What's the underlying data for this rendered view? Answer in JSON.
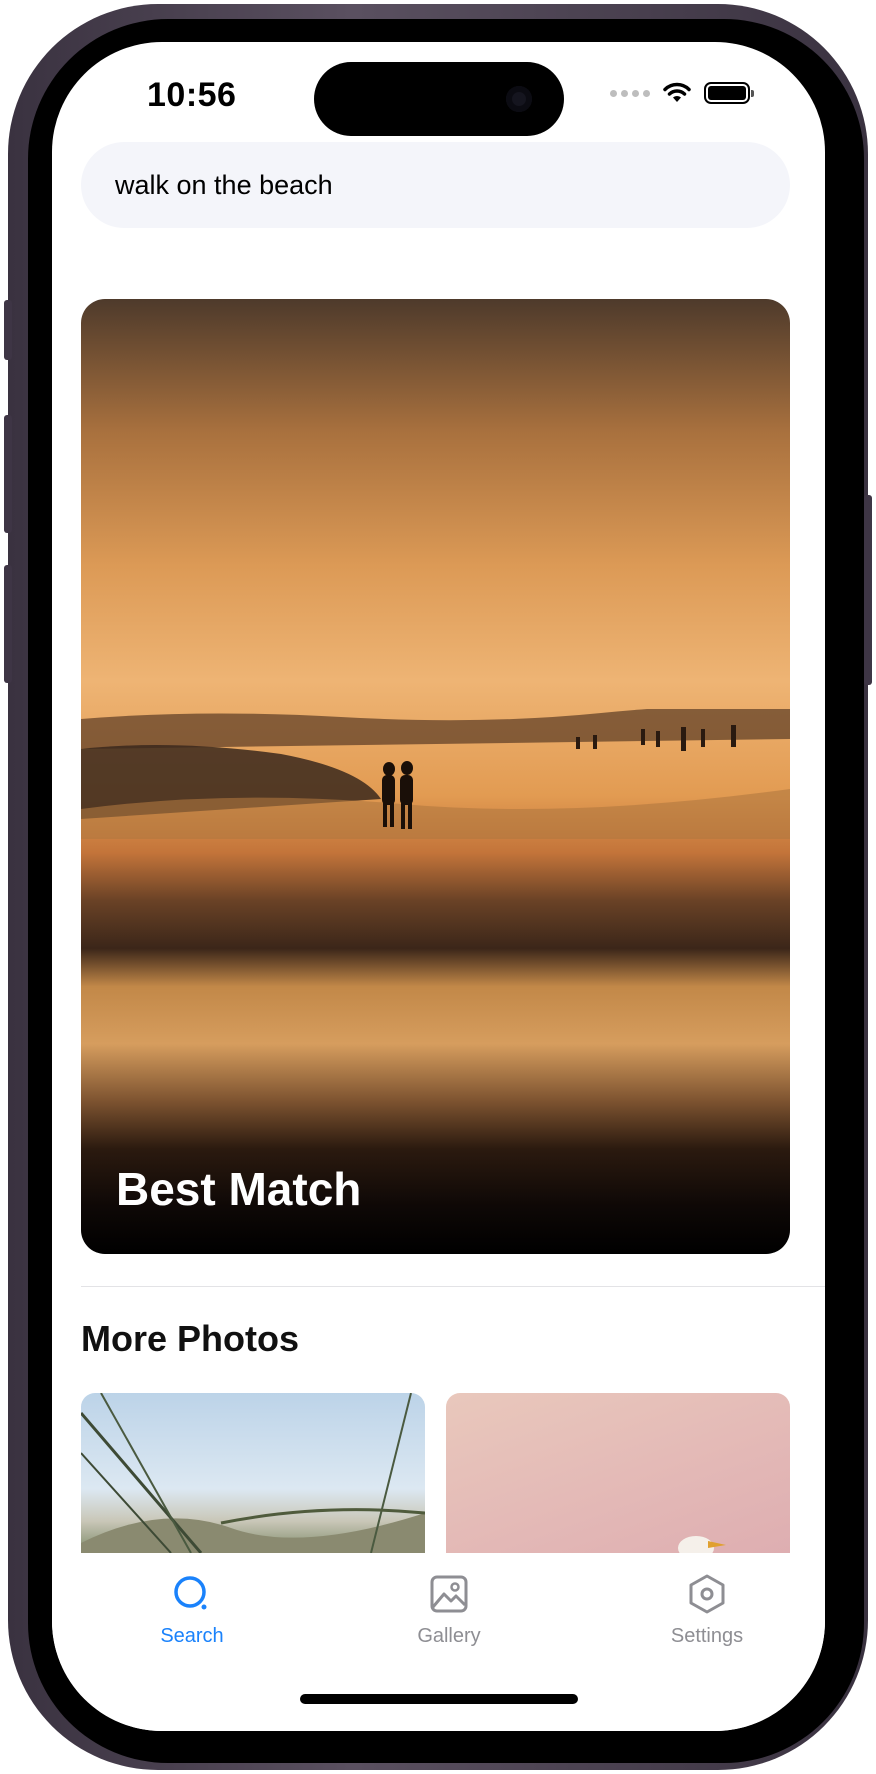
{
  "status_bar": {
    "time": "10:56"
  },
  "search": {
    "value": "walk on the beach"
  },
  "best_match": {
    "label": "Best Match"
  },
  "more_photos": {
    "title": "More Photos"
  },
  "tabs": [
    {
      "label": "Search",
      "icon": "search-icon",
      "active": true
    },
    {
      "label": "Gallery",
      "icon": "gallery-icon",
      "active": false
    },
    {
      "label": "Settings",
      "icon": "settings-icon",
      "active": false
    }
  ],
  "colors": {
    "accent": "#1a82fb",
    "inactive": "#8e8e93",
    "search_bg": "#f4f5fa"
  }
}
